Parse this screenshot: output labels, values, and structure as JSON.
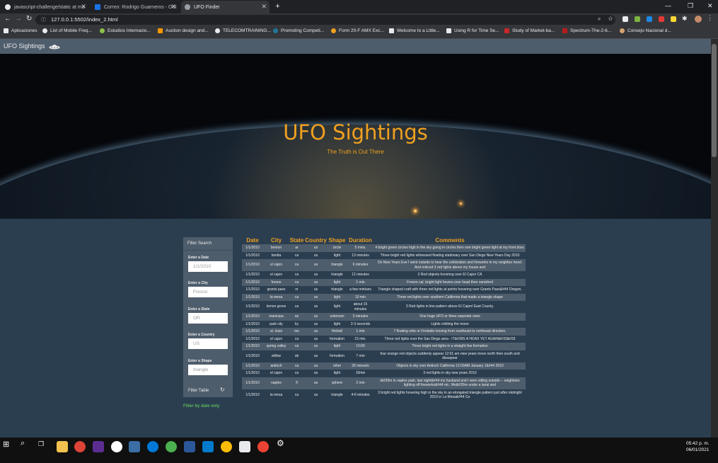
{
  "browser": {
    "tabs": [
      {
        "title": "javascript-challenge/static at ma"
      },
      {
        "title": "Correo: Rodrigo Guarneros - Out"
      },
      {
        "title": "UFO Finder"
      }
    ],
    "url": "127.0.0.1:5502/index_2.html",
    "bookmarks": [
      "Aplicaciones",
      "List of Mobile Freq...",
      "Estudios Internacio...",
      "Auction design and...",
      "TELECOMTRAINING...",
      "Promoting Competi...",
      "Form 20-F AMX Exc...",
      "Welcome to a Little...",
      "Using R for Time Se...",
      "Study of Market-ba...",
      "Spectrum-The-2-6...",
      "Consejo Nacional d..."
    ]
  },
  "navbar": {
    "brand": "UFO Sightings"
  },
  "hero": {
    "title": "UFO Sightings",
    "subtitle": "The Truth is Out There"
  },
  "filters": {
    "title": "Filter Search",
    "date": {
      "label": "Enter a Date",
      "placeholder": "1/1/2010"
    },
    "city": {
      "label": "Enter a City",
      "placeholder": "Fresno"
    },
    "state": {
      "label": "Enter a State",
      "placeholder": "OR"
    },
    "country": {
      "label": "Enter a Country",
      "placeholder": "US"
    },
    "shape": {
      "label": "Enter a Shape",
      "placeholder": "triangle"
    },
    "button": "Filter Table",
    "note": "Filter by date only"
  },
  "table": {
    "headers": [
      "Date",
      "City",
      "State",
      "Country",
      "Shape",
      "Duration",
      "Comments"
    ],
    "rows": [
      [
        "1/1/2010",
        "benton",
        "ar",
        "us",
        "circle",
        "5 mins.",
        "4 bright green circles high in the sky going in circles then one bright green light at my front door."
      ],
      [
        "1/1/2010",
        "bonita",
        "ca",
        "us",
        "light",
        "13 minutes",
        "Three bright red lights witnessed floating stationary over San Diego New Years Day 2010"
      ],
      [
        "1/1/2010",
        "el cajon",
        "ca",
        "us",
        "triangle",
        "6 minutes",
        "On New Years Eve I went outside to hear the celebration and fireworks in my neighbor hood. And noticed 3 red lights above my house and"
      ],
      [
        "1/1/2010",
        "el cajon",
        "ca",
        "us",
        "triangle",
        "12 minutes",
        "3 Red objects hovering over El Cajon CA"
      ],
      [
        "1/1/2010",
        "fresno",
        "ca",
        "us",
        "light",
        "1 min",
        "Fresno cal. bright light hovers over head then vanished"
      ],
      [
        "1/1/2010",
        "grants pass",
        "or",
        "us",
        "triangle",
        "a few mintues",
        "Triangle shaped craft with three red lights at points hovering over Grants Pass&#44 Oregon."
      ],
      [
        "1/1/2010",
        "la mesa",
        "ca",
        "us",
        "light",
        "10 min",
        "Three red lights over southern California that made a triangle shape"
      ],
      [
        "1/1/2010",
        "lemon grove",
        "ca",
        "us",
        "light",
        "about 15 minutes",
        "3 Red lights in line pattern above El Cajon/ East County."
      ],
      [
        "1/1/2010",
        "maricopa",
        "az",
        "us",
        "unknown",
        "3 minutes",
        "One huge UFO or three seperate ones"
      ],
      [
        "1/1/2010",
        "park city",
        "ky",
        "us",
        "light",
        "2-3 seconds",
        "Lights orbiting the moon"
      ],
      [
        "1/1/2010",
        "st. louis",
        "mo",
        "us",
        "fireball",
        "1 min",
        "7 floating orbs or Fireballs moving from southeast to northeast direction."
      ],
      [
        "1/1/2010",
        "el cajon",
        "ca",
        "us",
        "formation",
        "15 min.",
        "Three red lights over the San Diego area - IT&#39S A HOAX YET AGAIN&#33&#33"
      ],
      [
        "1/1/2010",
        "spring valley",
        "ca",
        "us",
        "light",
        "10:00",
        "Three bright red lights in a straight line formation"
      ],
      [
        "1/1/2010",
        "willow",
        "ak",
        "us",
        "formation",
        "7 min",
        "four orange red objects suddenly appear 12:01 am new years move north then south and dissapear"
      ],
      [
        "1/1/2010",
        "antioch",
        "ca",
        "us",
        "other",
        "30 minuets",
        "Objects in sky over Antioch California 12:03AM January 1&#44 2010"
      ],
      [
        "1/1/2010",
        "el cajon",
        "ca",
        "us",
        "light",
        "10min",
        "3 red lights in sky new years 2010"
      ],
      [
        "1/1/2010",
        "naples",
        "fl",
        "us",
        "sphere",
        "2 min",
        "i&#39m in naples park. last night&#44 my husband and I were sitting outside -- neighbors lighting off fireworks&#44 etc. We&#39re under a lanai and"
      ],
      [
        "1/1/2010",
        "la mesa",
        "ca",
        "us",
        "triangle",
        "4-6 minutes",
        "3 bright red lights hovering high in the sky in an elongated triangle pattern just after midnight 2010 in La Mesa&#44 Ca"
      ]
    ]
  },
  "taskbar": {
    "time": "05:42 p. m.",
    "date": "06/01/2021"
  }
}
